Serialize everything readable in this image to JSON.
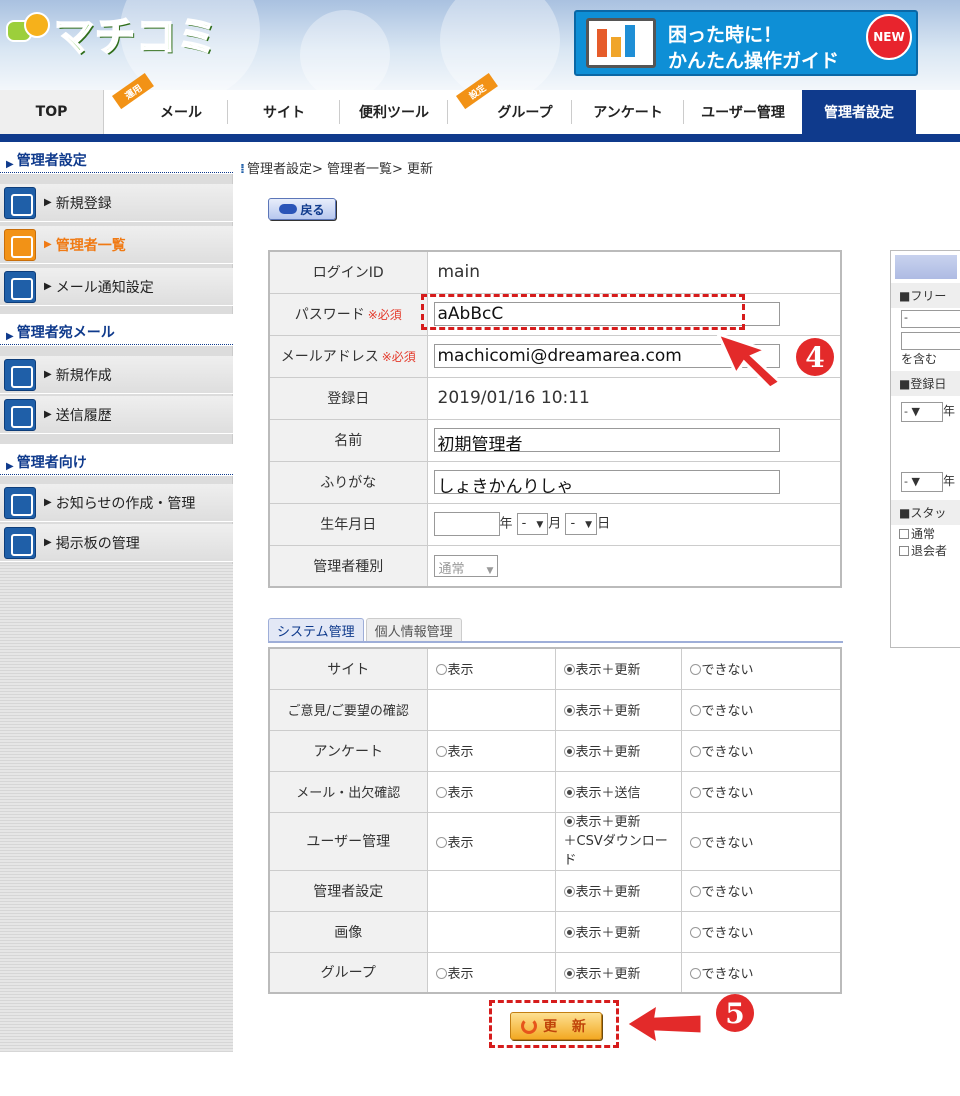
{
  "header": {
    "logo_text": "マチコミ",
    "guide_banner": {
      "line1": "困った時に！",
      "line2": "かんたん操作ガイド",
      "badge": "NEW"
    }
  },
  "nav": {
    "tabs": [
      {
        "label": "TOP"
      },
      {
        "label": "メール",
        "tag": "運用"
      },
      {
        "label": "サイト"
      },
      {
        "label": "便利ツール"
      },
      {
        "label": "グループ",
        "tag": "設定"
      },
      {
        "label": "アンケート"
      },
      {
        "label": "ユーザー管理"
      },
      {
        "label": "管理者設定",
        "active": true
      }
    ],
    "accent_color": "#0f3a8c"
  },
  "sidebar": {
    "sections": [
      {
        "title": "管理者設定",
        "items": [
          {
            "label": "新規登録"
          },
          {
            "label": "管理者一覧",
            "active": true
          },
          {
            "label": "メール通知設定"
          }
        ]
      },
      {
        "title": "管理者宛メール",
        "items": [
          {
            "label": "新規作成"
          },
          {
            "label": "送信履歴"
          }
        ]
      },
      {
        "title": "管理者向け",
        "items": [
          {
            "label": "お知らせの作成・管理"
          },
          {
            "label": "掲示板の管理"
          }
        ]
      }
    ]
  },
  "breadcrumb": "管理者設定> 管理者一覧> 更新",
  "back_button": "戻る",
  "required_mark": "※必須",
  "form": {
    "login_id": {
      "label": "ログインID",
      "value": "main"
    },
    "password": {
      "label": "パスワード",
      "value": "aAbBcC"
    },
    "email": {
      "label": "メールアドレス",
      "value": "machicomi@dreamarea.com"
    },
    "registered": {
      "label": "登録日",
      "value": "2019/01/16 10:11"
    },
    "name": {
      "label": "名前",
      "value": "初期管理者"
    },
    "furigana": {
      "label": "ふりがな",
      "value": "しょきかんりしゃ"
    },
    "birthday": {
      "label": "生年月日",
      "year_unit": "年",
      "month_value": "-",
      "month_unit": "月",
      "day_value": "-",
      "day_unit": "日"
    },
    "admin_type": {
      "label": "管理者種別",
      "value": "通常"
    }
  },
  "perm_tabs": [
    {
      "label": "システム管理",
      "active": true
    },
    {
      "label": "個人情報管理"
    }
  ],
  "permissions": [
    {
      "label": "サイト",
      "opt1": "表示",
      "opt2": "表示＋更新",
      "opt3": "できない",
      "selected": 2
    },
    {
      "label": "ご意見/ご要望の確認",
      "opt1": "",
      "opt2": "表示＋更新",
      "opt3": "できない",
      "selected": 2
    },
    {
      "label": "アンケート",
      "opt1": "表示",
      "opt2": "表示＋更新",
      "opt3": "できない",
      "selected": 2
    },
    {
      "label": "メール・出欠確認",
      "opt1": "表示",
      "opt2": "表示＋送信",
      "opt3": "できない",
      "selected": 2
    },
    {
      "label": "ユーザー管理",
      "opt1": "表示",
      "opt2": "表示＋更新",
      "opt2b": "＋CSVダウンロード",
      "opt3": "できない",
      "selected": 2
    },
    {
      "label": "管理者設定",
      "opt1": "",
      "opt2": "表示＋更新",
      "opt3": "できない",
      "selected": 2
    },
    {
      "label": "画像",
      "opt1": "",
      "opt2": "表示＋更新",
      "opt3": "できない",
      "selected": 2
    },
    {
      "label": "グループ",
      "opt1": "表示",
      "opt2": "表示＋更新",
      "opt3": "できない",
      "selected": 2
    }
  ],
  "update_button": "更 新",
  "annotations": {
    "step4": "4",
    "step5": "5",
    "color": "#d61c1c"
  },
  "search_panel": {
    "free_word_label": "■フリー",
    "free_word_value": "-",
    "contains_label": "を含む",
    "reg_date_label": "■登録日",
    "year_select": "-",
    "year_unit": "年",
    "status_label": "■スタッ",
    "status_options": [
      "通常",
      "退会者"
    ]
  }
}
